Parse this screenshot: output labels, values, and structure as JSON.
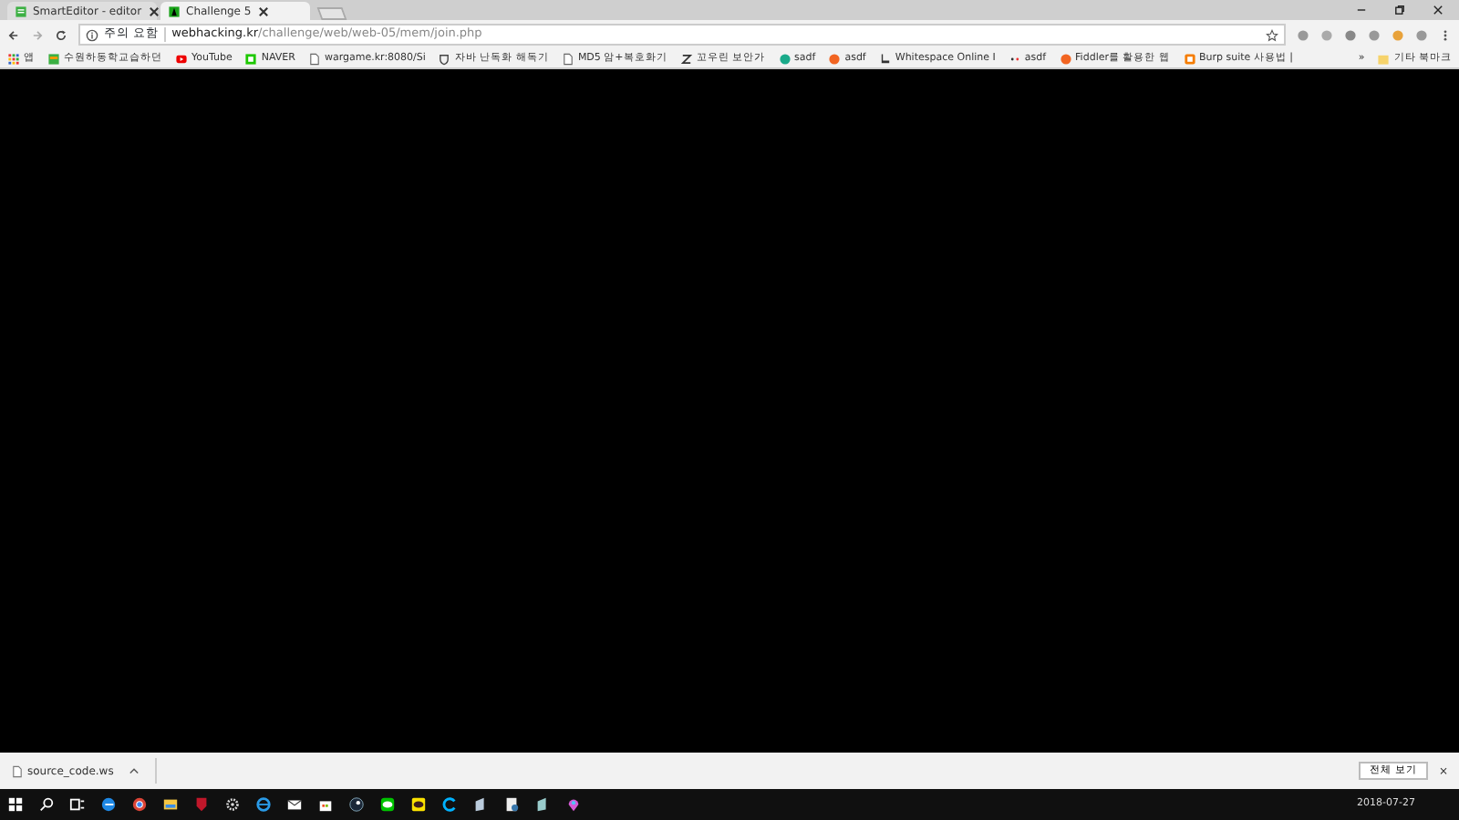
{
  "tabs": [
    {
      "title": "SmartEditor - editor",
      "selected": false,
      "kind": "editor"
    },
    {
      "title": "Challenge 5",
      "selected": true,
      "kind": "challenge"
    }
  ],
  "address_bar": {
    "security_label": "주의 요함",
    "host": "webhacking.kr",
    "path": "/challenge/web/web-05/mem/join.php"
  },
  "bookmarks": [
    {
      "label": "앱",
      "kind": "apps"
    },
    {
      "label": "수원하동학교습하던",
      "kind": "green"
    },
    {
      "label": "YouTube",
      "kind": "youtube"
    },
    {
      "label": "NAVER",
      "kind": "naver"
    },
    {
      "label": "wargame.kr:8080/Si",
      "kind": "page"
    },
    {
      "label": "자바 난독화 해독기",
      "kind": "shield"
    },
    {
      "label": "MD5 암+복호화기",
      "kind": "page"
    },
    {
      "label": "꼬우린 보안가",
      "kind": "z"
    },
    {
      "label": "sadf",
      "kind": "teal"
    },
    {
      "label": "asdf",
      "kind": "orange"
    },
    {
      "label": "Whitespace Online I",
      "kind": "dark"
    },
    {
      "label": "asdf",
      "kind": "dots"
    },
    {
      "label": "Fiddler를 활용한 웹",
      "kind": "orange"
    },
    {
      "label": "Burp suite 사용법 |",
      "kind": "blogger"
    }
  ],
  "bookmarks_overflow": "»",
  "other_bookmarks": "기타 북마크",
  "download_bar": {
    "file": "source_code.ws",
    "show_all": "전체 보기",
    "close": "×"
  },
  "taskbar": {
    "date": "2018-07-27"
  }
}
